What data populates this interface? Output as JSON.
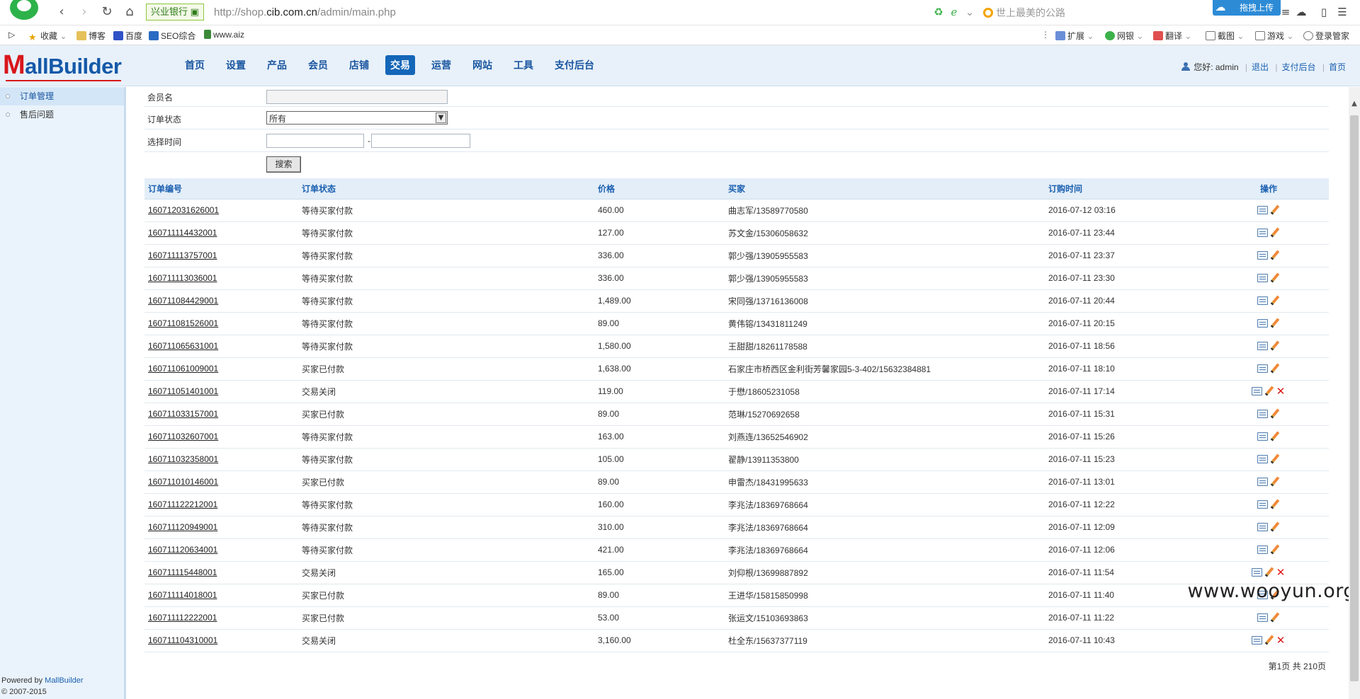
{
  "browser": {
    "bank_badge": "兴业银行 ▣",
    "url_prefix": "http://shop.",
    "url_domain": "cib.com.cn",
    "url_path": "/admin/main.php",
    "search_placeholder": "世上最美的公路",
    "upload_label": "拖拽上传",
    "bookmarks": [
      {
        "label": "收藏",
        "icon": "star-icon"
      },
      {
        "label": "博客",
        "icon": "folder-icon"
      },
      {
        "label": "百度",
        "icon": "baidu-icon"
      },
      {
        "label": "SEO综合",
        "icon": "seo-icon"
      },
      {
        "label": "www.aiz",
        "icon": "site-icon"
      }
    ],
    "tools": [
      "扩展",
      "网银",
      "翻译",
      "截图",
      "游戏",
      "登录管家"
    ]
  },
  "header": {
    "logo_first": "M",
    "logo_rest": "allBuilder",
    "nav": [
      "首页",
      "设置",
      "产品",
      "会员",
      "店铺",
      "交易",
      "运营",
      "网站",
      "工具",
      "支付后台"
    ],
    "active_nav_index": 5,
    "greeting": "您好: admin",
    "links": [
      "退出",
      "支付后台",
      "首页"
    ]
  },
  "sidebar": {
    "items": [
      "订单管理",
      "售后问题"
    ],
    "active_index": 0,
    "footer_powered": "Powered by ",
    "footer_brand": "MallBuilder",
    "footer_copy": "© 2007-2015"
  },
  "filters": {
    "member_label": "会员名",
    "member_value": "",
    "status_label": "订单状态",
    "status_value": "所有",
    "time_label": "选择时间",
    "time_from": "",
    "time_to": "",
    "date_separator": "-",
    "search_button": "搜索"
  },
  "table": {
    "headers": [
      "订单编号",
      "订单状态",
      "价格",
      "买家",
      "订购时间",
      "操作"
    ],
    "rows": [
      {
        "id": "160712031626001",
        "status": "等待买家付款",
        "price": "460.00",
        "buyer": "曲志军/13589770580",
        "time": "2016-07-12 03:16",
        "deletable": false
      },
      {
        "id": "160711114432001",
        "status": "等待买家付款",
        "price": "127.00",
        "buyer": "苏文金/15306058632",
        "time": "2016-07-11 23:44",
        "deletable": false
      },
      {
        "id": "160711113757001",
        "status": "等待买家付款",
        "price": "336.00",
        "buyer": "郭少强/13905955583",
        "time": "2016-07-11 23:37",
        "deletable": false
      },
      {
        "id": "160711113036001",
        "status": "等待买家付款",
        "price": "336.00",
        "buyer": "郭少强/13905955583",
        "time": "2016-07-11 23:30",
        "deletable": false
      },
      {
        "id": "160711084429001",
        "status": "等待买家付款",
        "price": "1,489.00",
        "buyer": "宋同强/13716136008",
        "time": "2016-07-11 20:44",
        "deletable": false
      },
      {
        "id": "160711081526001",
        "status": "等待买家付款",
        "price": "89.00",
        "buyer": "黄伟镕/13431811249",
        "time": "2016-07-11 20:15",
        "deletable": false
      },
      {
        "id": "160711065631001",
        "status": "等待买家付款",
        "price": "1,580.00",
        "buyer": "王甜甜/18261178588",
        "time": "2016-07-11 18:56",
        "deletable": false
      },
      {
        "id": "160711061009001",
        "status": "买家已付款",
        "price": "1,638.00",
        "buyer": "石家庄市桥西区金利街芳馨家园5-3-402/15632384881",
        "time": "2016-07-11 18:10",
        "deletable": false
      },
      {
        "id": "160711051401001",
        "status": "交易关闭",
        "price": "119.00",
        "buyer": "于懋/18605231058",
        "time": "2016-07-11 17:14",
        "deletable": true
      },
      {
        "id": "160711033157001",
        "status": "买家已付款",
        "price": "89.00",
        "buyer": "范琳/15270692658",
        "time": "2016-07-11 15:31",
        "deletable": false
      },
      {
        "id": "160711032607001",
        "status": "等待买家付款",
        "price": "163.00",
        "buyer": "刘燕连/13652546902",
        "time": "2016-07-11 15:26",
        "deletable": false
      },
      {
        "id": "160711032358001",
        "status": "等待买家付款",
        "price": "105.00",
        "buyer": "翟静/13911353800",
        "time": "2016-07-11 15:23",
        "deletable": false
      },
      {
        "id": "160711010146001",
        "status": "买家已付款",
        "price": "89.00",
        "buyer": "申雷杰/18431995633",
        "time": "2016-07-11 13:01",
        "deletable": false
      },
      {
        "id": "160711122212001",
        "status": "等待买家付款",
        "price": "160.00",
        "buyer": "李兆法/18369768664",
        "time": "2016-07-11 12:22",
        "deletable": false
      },
      {
        "id": "160711120949001",
        "status": "等待买家付款",
        "price": "310.00",
        "buyer": "李兆法/18369768664",
        "time": "2016-07-11 12:09",
        "deletable": false
      },
      {
        "id": "160711120634001",
        "status": "等待买家付款",
        "price": "421.00",
        "buyer": "李兆法/18369768664",
        "time": "2016-07-11 12:06",
        "deletable": false
      },
      {
        "id": "160711115448001",
        "status": "交易关闭",
        "price": "165.00",
        "buyer": "刘仰根/13699887892",
        "time": "2016-07-11 11:54",
        "deletable": true
      },
      {
        "id": "160711114018001",
        "status": "买家已付款",
        "price": "89.00",
        "buyer": "王进华/15815850998",
        "time": "2016-07-11 11:40",
        "deletable": false
      },
      {
        "id": "160711112222001",
        "status": "买家已付款",
        "price": "53.00",
        "buyer": "张运文/15103693863",
        "time": "2016-07-11 11:22",
        "deletable": false
      },
      {
        "id": "160711104310001",
        "status": "交易关闭",
        "price": "3,160.00",
        "buyer": "杜全东/15637377119",
        "time": "2016-07-11 10:43",
        "deletable": true
      }
    ]
  },
  "pagination": "第1页 共 210页",
  "watermark": "www.wooyun.org",
  "colors": {
    "accent": "#1466b8",
    "logo_red": "#d8161c",
    "logo_blue": "#1559a8",
    "header_bg": "#e8f1fa",
    "delete": "#e01818"
  }
}
